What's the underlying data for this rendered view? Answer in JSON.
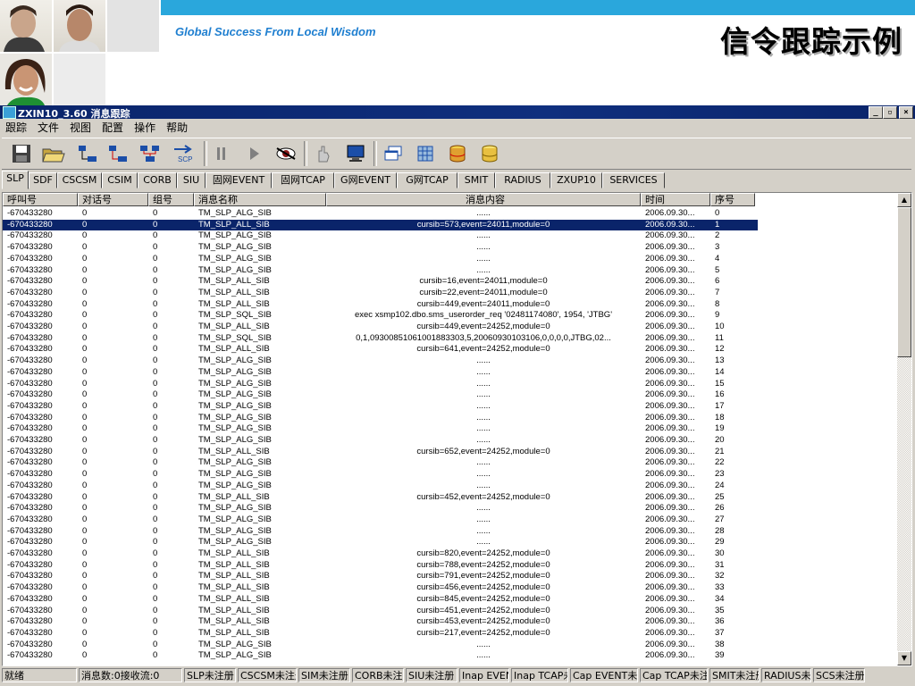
{
  "slide": {
    "slogan": "Global Success From Local Wisdom",
    "title": "信令跟踪示例"
  },
  "window": {
    "title": "ZXIN10_3.60 消息跟踪",
    "controls": [
      "_",
      "▫",
      "×"
    ]
  },
  "menu": [
    "跟踪",
    "文件",
    "视图",
    "配置",
    "操作",
    "帮助"
  ],
  "toolbar": {
    "icons": [
      "save-icon",
      "open-folder-icon",
      "network-connect-icon",
      "network-disconnect-icon",
      "network-group-icon",
      "scp-transfer-icon",
      "pause-icon",
      "play-icon",
      "eye-icon",
      "filter-hand-icon",
      "monitor-icon",
      "window-copy-icon",
      "grid-icon",
      "database-icon",
      "database-coin-icon"
    ]
  },
  "tabs": [
    "SLP",
    "SDF",
    "CSCSM",
    "CSIM",
    "CORB",
    "SIU",
    "固网EVENT",
    "固网TCAP",
    "G网EVENT",
    "G网TCAP",
    "SMIT",
    "RADIUS",
    "ZXUP10",
    "SERVICES"
  ],
  "active_tab": "SLP",
  "grid": {
    "columns": [
      "呼叫号",
      "对话号",
      "组号",
      "消息名称",
      "消息内容",
      "时间",
      "序号"
    ],
    "selected_row": 1,
    "rows": [
      [
        "-670433280",
        "0",
        "0",
        "TM_SLP_ALG_SIB",
        "......",
        "2006.09.30...",
        "0"
      ],
      [
        "-670433280",
        "0",
        "0",
        "TM_SLP_ALL_SIB",
        "cursib=573,event=24011,module=0",
        "2006.09.30...",
        "1"
      ],
      [
        "-670433280",
        "0",
        "0",
        "TM_SLP_ALG_SIB",
        "......",
        "2006.09.30...",
        "2"
      ],
      [
        "-670433280",
        "0",
        "0",
        "TM_SLP_ALG_SIB",
        "......",
        "2006.09.30...",
        "3"
      ],
      [
        "-670433280",
        "0",
        "0",
        "TM_SLP_ALG_SIB",
        "......",
        "2006.09.30...",
        "4"
      ],
      [
        "-670433280",
        "0",
        "0",
        "TM_SLP_ALG_SIB",
        "......",
        "2006.09.30...",
        "5"
      ],
      [
        "-670433280",
        "0",
        "0",
        "TM_SLP_ALL_SIB",
        "cursib=16,event=24011,module=0",
        "2006.09.30...",
        "6"
      ],
      [
        "-670433280",
        "0",
        "0",
        "TM_SLP_ALL_SIB",
        "cursib=22,event=24011,module=0",
        "2006.09.30...",
        "7"
      ],
      [
        "-670433280",
        "0",
        "0",
        "TM_SLP_ALL_SIB",
        "cursib=449,event=24011,module=0",
        "2006.09.30...",
        "8"
      ],
      [
        "-670433280",
        "0",
        "0",
        "TM_SLP_SQL_SIB",
        "exec xsmp102.dbo.sms_userorder_req '02481174080', 1954, 'JTBG'",
        "2006.09.30...",
        "9"
      ],
      [
        "-670433280",
        "0",
        "0",
        "TM_SLP_ALL_SIB",
        "cursib=449,event=24252,module=0",
        "2006.09.30...",
        "10"
      ],
      [
        "-670433280",
        "0",
        "0",
        "TM_SLP_SQL_SIB",
        "0,1,09300851061001883303,5,20060930103106,0,0,0,0,JTBG,02...",
        "2006.09.30...",
        "11"
      ],
      [
        "-670433280",
        "0",
        "0",
        "TM_SLP_ALL_SIB",
        "cursib=641,event=24252,module=0",
        "2006.09.30...",
        "12"
      ],
      [
        "-670433280",
        "0",
        "0",
        "TM_SLP_ALG_SIB",
        "......",
        "2006.09.30...",
        "13"
      ],
      [
        "-670433280",
        "0",
        "0",
        "TM_SLP_ALG_SIB",
        "......",
        "2006.09.30...",
        "14"
      ],
      [
        "-670433280",
        "0",
        "0",
        "TM_SLP_ALG_SIB",
        "......",
        "2006.09.30...",
        "15"
      ],
      [
        "-670433280",
        "0",
        "0",
        "TM_SLP_ALG_SIB",
        "......",
        "2006.09.30...",
        "16"
      ],
      [
        "-670433280",
        "0",
        "0",
        "TM_SLP_ALG_SIB",
        "......",
        "2006.09.30...",
        "17"
      ],
      [
        "-670433280",
        "0",
        "0",
        "TM_SLP_ALG_SIB",
        "......",
        "2006.09.30...",
        "18"
      ],
      [
        "-670433280",
        "0",
        "0",
        "TM_SLP_ALG_SIB",
        "......",
        "2006.09.30...",
        "19"
      ],
      [
        "-670433280",
        "0",
        "0",
        "TM_SLP_ALG_SIB",
        "......",
        "2006.09.30...",
        "20"
      ],
      [
        "-670433280",
        "0",
        "0",
        "TM_SLP_ALL_SIB",
        "cursib=652,event=24252,module=0",
        "2006.09.30...",
        "21"
      ],
      [
        "-670433280",
        "0",
        "0",
        "TM_SLP_ALG_SIB",
        "......",
        "2006.09.30...",
        "22"
      ],
      [
        "-670433280",
        "0",
        "0",
        "TM_SLP_ALG_SIB",
        "......",
        "2006.09.30...",
        "23"
      ],
      [
        "-670433280",
        "0",
        "0",
        "TM_SLP_ALG_SIB",
        "......",
        "2006.09.30...",
        "24"
      ],
      [
        "-670433280",
        "0",
        "0",
        "TM_SLP_ALL_SIB",
        "cursib=452,event=24252,module=0",
        "2006.09.30...",
        "25"
      ],
      [
        "-670433280",
        "0",
        "0",
        "TM_SLP_ALG_SIB",
        "......",
        "2006.09.30...",
        "26"
      ],
      [
        "-670433280",
        "0",
        "0",
        "TM_SLP_ALG_SIB",
        "......",
        "2006.09.30...",
        "27"
      ],
      [
        "-670433280",
        "0",
        "0",
        "TM_SLP_ALG_SIB",
        "......",
        "2006.09.30...",
        "28"
      ],
      [
        "-670433280",
        "0",
        "0",
        "TM_SLP_ALG_SIB",
        "......",
        "2006.09.30...",
        "29"
      ],
      [
        "-670433280",
        "0",
        "0",
        "TM_SLP_ALL_SIB",
        "cursib=820,event=24252,module=0",
        "2006.09.30...",
        "30"
      ],
      [
        "-670433280",
        "0",
        "0",
        "TM_SLP_ALL_SIB",
        "cursib=788,event=24252,module=0",
        "2006.09.30...",
        "31"
      ],
      [
        "-670433280",
        "0",
        "0",
        "TM_SLP_ALL_SIB",
        "cursib=791,event=24252,module=0",
        "2006.09.30...",
        "32"
      ],
      [
        "-670433280",
        "0",
        "0",
        "TM_SLP_ALL_SIB",
        "cursib=456,event=24252,module=0",
        "2006.09.30...",
        "33"
      ],
      [
        "-670433280",
        "0",
        "0",
        "TM_SLP_ALL_SIB",
        "cursib=845,event=24252,module=0",
        "2006.09.30...",
        "34"
      ],
      [
        "-670433280",
        "0",
        "0",
        "TM_SLP_ALL_SIB",
        "cursib=451,event=24252,module=0",
        "2006.09.30...",
        "35"
      ],
      [
        "-670433280",
        "0",
        "0",
        "TM_SLP_ALL_SIB",
        "cursib=453,event=24252,module=0",
        "2006.09.30...",
        "36"
      ],
      [
        "-670433280",
        "0",
        "0",
        "TM_SLP_ALL_SIB",
        "cursib=217,event=24252,module=0",
        "2006.09.30...",
        "37"
      ],
      [
        "-670433280",
        "0",
        "0",
        "TM_SLP_ALG_SIB",
        "......",
        "2006.09.30...",
        "38"
      ],
      [
        "-670433280",
        "0",
        "0",
        "TM_SLP_ALG_SIB",
        "......",
        "2006.09.30...",
        "39"
      ]
    ]
  },
  "status": [
    "就绪",
    "消息数:0接收流:0",
    "SLP未注册",
    "CSCSM未注册",
    "SIM未注册",
    "CORB未注册",
    "SIU未注册",
    "Inap EVEN",
    "Inap TCAP未",
    "Cap EVENT未注",
    "Cap TCAP未注册",
    "SMIT未注册",
    "RADIUS未注",
    "SCS未注册"
  ],
  "colors": {
    "accent": "#0a246a",
    "band": "#2aa7dc",
    "slogan": "#1f7fd0",
    "face": "#d4d0c8"
  }
}
